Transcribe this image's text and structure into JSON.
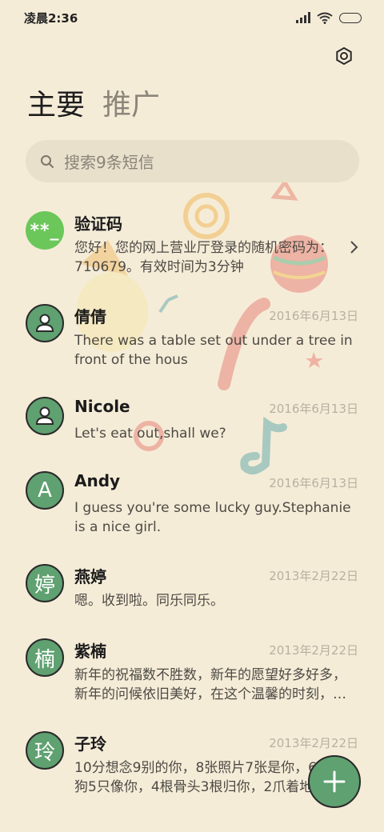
{
  "status_bar": {
    "time": "凌晨2:36"
  },
  "tabs": [
    {
      "label": "主要",
      "active": true
    },
    {
      "label": "推广",
      "active": false
    }
  ],
  "search": {
    "placeholder": "搜索9条短信"
  },
  "threads": [
    {
      "name": "验证码",
      "date": "",
      "preview": "您好！您的网上营业厅登录的随机密码为：710679。有效时间为3分钟",
      "avatar_text": "**_",
      "avatar_type": "code"
    },
    {
      "name": "倩倩",
      "date": "2016年6月13日",
      "preview": "There was a table set out under a tree in front of the hous",
      "avatar_text": "",
      "avatar_type": "person"
    },
    {
      "name": "Nicole",
      "date": "2016年6月13日",
      "preview": "Let's eat out,shall we?",
      "avatar_text": "",
      "avatar_type": "person"
    },
    {
      "name": "Andy",
      "date": "2016年6月13日",
      "preview": "I guess you're some lucky guy.Stephanie is a nice girl.",
      "avatar_text": "A",
      "avatar_type": "letter"
    },
    {
      "name": "燕婷",
      "date": "2013年2月22日",
      "preview": "嗯。收到啦。同乐同乐。",
      "avatar_text": "婷",
      "avatar_type": "letter"
    },
    {
      "name": "紫楠",
      "date": "2013年2月22日",
      "preview": "新年的祝福数不胜数，新年的愿望好多好多，新年的问候依旧美好，在这个温馨的时刻，…",
      "avatar_text": "楠",
      "avatar_type": "letter"
    },
    {
      "name": "子玲",
      "date": "2013年2月22日",
      "preview": "10分想念9别的你，8张照片7张是你，6只小狗5只像你，4根骨头3根归你，2爪着地",
      "avatar_text": "玲",
      "avatar_type": "letter"
    }
  ],
  "colors": {
    "background": "#f5ecd8",
    "accent": "#5fa170",
    "code_avatar": "#6bc75a"
  }
}
